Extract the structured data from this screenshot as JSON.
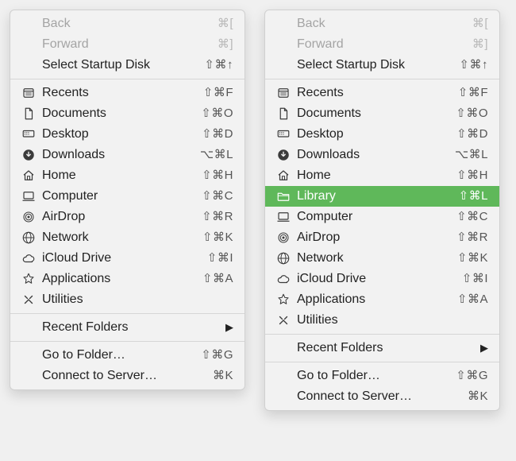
{
  "menus": [
    {
      "id": "left",
      "sections": [
        [
          {
            "name": "back",
            "label": "Back",
            "shortcut": "⌘[",
            "icon": null,
            "disabled": true
          },
          {
            "name": "forward",
            "label": "Forward",
            "shortcut": "⌘]",
            "icon": null,
            "disabled": true
          },
          {
            "name": "select-startup-disk",
            "label": "Select Startup Disk",
            "shortcut": "⇧⌘↑",
            "icon": null
          }
        ],
        [
          {
            "name": "recents",
            "label": "Recents",
            "shortcut": "⇧⌘F",
            "icon": "recents"
          },
          {
            "name": "documents",
            "label": "Documents",
            "shortcut": "⇧⌘O",
            "icon": "document"
          },
          {
            "name": "desktop",
            "label": "Desktop",
            "shortcut": "⇧⌘D",
            "icon": "desktop"
          },
          {
            "name": "downloads",
            "label": "Downloads",
            "shortcut": "⌥⌘L",
            "icon": "downloads"
          },
          {
            "name": "home",
            "label": "Home",
            "shortcut": "⇧⌘H",
            "icon": "home"
          },
          {
            "name": "computer",
            "label": "Computer",
            "shortcut": "⇧⌘C",
            "icon": "computer"
          },
          {
            "name": "airdrop",
            "label": "AirDrop",
            "shortcut": "⇧⌘R",
            "icon": "airdrop"
          },
          {
            "name": "network",
            "label": "Network",
            "shortcut": "⇧⌘K",
            "icon": "network"
          },
          {
            "name": "icloud-drive",
            "label": "iCloud Drive",
            "shortcut": "⇧⌘I",
            "icon": "cloud"
          },
          {
            "name": "applications",
            "label": "Applications",
            "shortcut": "⇧⌘A",
            "icon": "apps"
          },
          {
            "name": "utilities",
            "label": "Utilities",
            "shortcut": "",
            "icon": "utilities"
          }
        ],
        [
          {
            "name": "recent-folders",
            "label": "Recent Folders",
            "shortcut": "",
            "icon": null,
            "submenu": true
          }
        ],
        [
          {
            "name": "go-to-folder",
            "label": "Go to Folder…",
            "shortcut": "⇧⌘G",
            "icon": null
          },
          {
            "name": "connect-to-server",
            "label": "Connect to Server…",
            "shortcut": "⌘K",
            "icon": null
          }
        ]
      ]
    },
    {
      "id": "right",
      "sections": [
        [
          {
            "name": "back",
            "label": "Back",
            "shortcut": "⌘[",
            "icon": null,
            "disabled": true
          },
          {
            "name": "forward",
            "label": "Forward",
            "shortcut": "⌘]",
            "icon": null,
            "disabled": true
          },
          {
            "name": "select-startup-disk",
            "label": "Select Startup Disk",
            "shortcut": "⇧⌘↑",
            "icon": null
          }
        ],
        [
          {
            "name": "recents",
            "label": "Recents",
            "shortcut": "⇧⌘F",
            "icon": "recents"
          },
          {
            "name": "documents",
            "label": "Documents",
            "shortcut": "⇧⌘O",
            "icon": "document"
          },
          {
            "name": "desktop",
            "label": "Desktop",
            "shortcut": "⇧⌘D",
            "icon": "desktop"
          },
          {
            "name": "downloads",
            "label": "Downloads",
            "shortcut": "⌥⌘L",
            "icon": "downloads"
          },
          {
            "name": "home",
            "label": "Home",
            "shortcut": "⇧⌘H",
            "icon": "home"
          },
          {
            "name": "library",
            "label": "Library",
            "shortcut": "⇧⌘L",
            "icon": "folder",
            "highlight": true
          },
          {
            "name": "computer",
            "label": "Computer",
            "shortcut": "⇧⌘C",
            "icon": "computer"
          },
          {
            "name": "airdrop",
            "label": "AirDrop",
            "shortcut": "⇧⌘R",
            "icon": "airdrop"
          },
          {
            "name": "network",
            "label": "Network",
            "shortcut": "⇧⌘K",
            "icon": "network"
          },
          {
            "name": "icloud-drive",
            "label": "iCloud Drive",
            "shortcut": "⇧⌘I",
            "icon": "cloud"
          },
          {
            "name": "applications",
            "label": "Applications",
            "shortcut": "⇧⌘A",
            "icon": "apps"
          },
          {
            "name": "utilities",
            "label": "Utilities",
            "shortcut": "",
            "icon": "utilities"
          }
        ],
        [
          {
            "name": "recent-folders",
            "label": "Recent Folders",
            "shortcut": "",
            "icon": null,
            "submenu": true
          }
        ],
        [
          {
            "name": "go-to-folder",
            "label": "Go to Folder…",
            "shortcut": "⇧⌘G",
            "icon": null
          },
          {
            "name": "connect-to-server",
            "label": "Connect to Server…",
            "shortcut": "⌘K",
            "icon": null
          }
        ]
      ]
    }
  ]
}
